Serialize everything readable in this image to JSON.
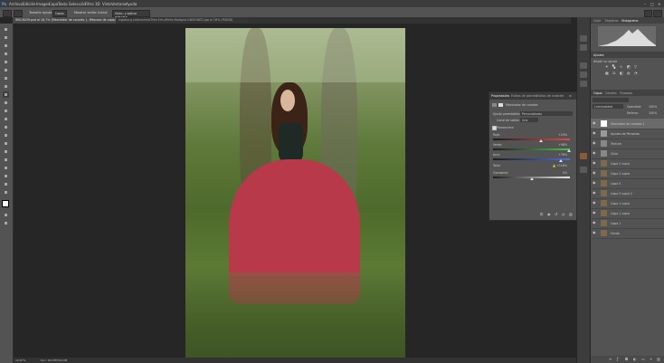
{
  "menu": [
    "Archivo",
    "Edición",
    "Imagen",
    "Capa",
    "Texto",
    "Selección",
    "Filtro",
    "3D",
    "Vista",
    "Ventana",
    "Ayuda"
  ],
  "options": {
    "size_label": "Tamaño ajuste",
    "style_value": "Capas",
    "sample_label": "Mostrar anillo: Inicial",
    "sample_btn": "Selec. y aplicar máscara..."
  },
  "tabs": [
    "IMG-8039.psd al 16,7% (Mezclador de canales 1, Máscara de capa/8)",
    "Ingeborg-Lebensheid-Tree-Eirs-White-Badigne-UNSIGNED.jpg al 16% (RGB/8)"
  ],
  "status": {
    "zoom": "16,67%",
    "doc": "Doc: 96,7M/530,0M"
  },
  "right": {
    "top_tabs": [
      "Color",
      "Muestras",
      "Histograma"
    ],
    "adjust_tab": "Ajustes",
    "adjust_sub": "Añadir un ajuste",
    "layers_tabs": [
      "Capas",
      "Canales",
      "Trazados"
    ],
    "blend": "Luminosidad",
    "opacity_label": "Opacidad:",
    "opacity": "100%",
    "fill_label": "Relleno:",
    "fill": "100%",
    "layers": [
      "Mezclador de canales 1",
      "Ajustes de Personas",
      "Textura",
      "Cielo",
      "Capa 2 copia",
      "Capa 2 copia",
      "Capa 3",
      "Capa 3 copia 2",
      "Capa 1 copia",
      "Capa 1 copia",
      "Capa 1",
      "Fondo"
    ]
  },
  "props": {
    "tabs": [
      "Propiedades",
      "Estilos de párrafo",
      "Estilos de carácter"
    ],
    "title": "Mezclador de canales",
    "preset_label": "Ajuste preestablecido:",
    "preset_value": "Personalizado",
    "channel_label": "Canal de salida:",
    "channel_value": "Gris",
    "mono_label": "Monocromo",
    "red_label": "Rojo:",
    "red_value": "+24%",
    "green_label": "Verde:",
    "green_value": "+98%",
    "blue_label": "Azul:",
    "blue_value": "+76%",
    "total_label": "Total:",
    "total_value": "+118%",
    "const_label": "Constante:",
    "const_value": "0%",
    "red_level": 0.62,
    "green_level": 0.99,
    "blue_level": 0.88,
    "const_level": 0.5
  }
}
